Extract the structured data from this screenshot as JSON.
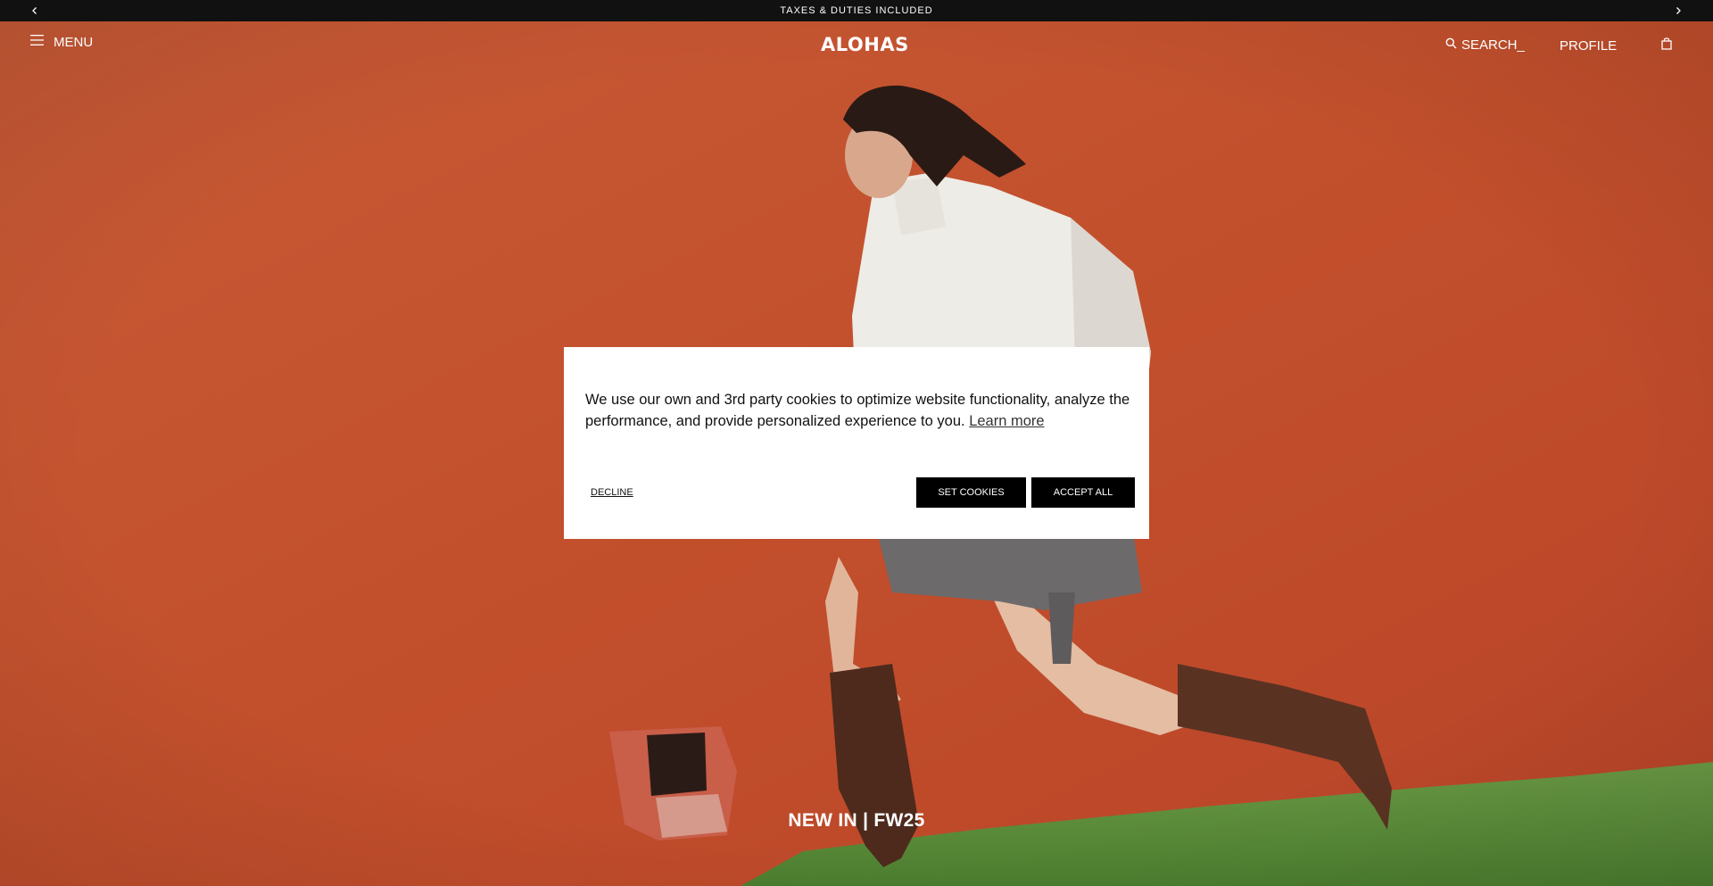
{
  "announcement": {
    "text": "TAXES & DUTIES INCLUDED",
    "prev_icon": "chevron-left-icon",
    "next_icon": "chevron-right-icon"
  },
  "header": {
    "menu_label": "MENU",
    "logo": "ALOHAS",
    "search_label": "SEARCH_",
    "profile_label": "PROFILE",
    "bag_icon": "shopping-bag-icon"
  },
  "hero": {
    "caption": "NEW IN | FW25",
    "background_color": "#c3512e"
  },
  "cookie_banner": {
    "message": "We use our own and 3rd party cookies to optimize website functionality, analyze the performance, and provide personalized experience to you.",
    "learn_more": "Learn more",
    "decline_label": "DECLINE",
    "set_cookies_label": "SET COOKIES",
    "accept_all_label": "ACCEPT ALL"
  }
}
